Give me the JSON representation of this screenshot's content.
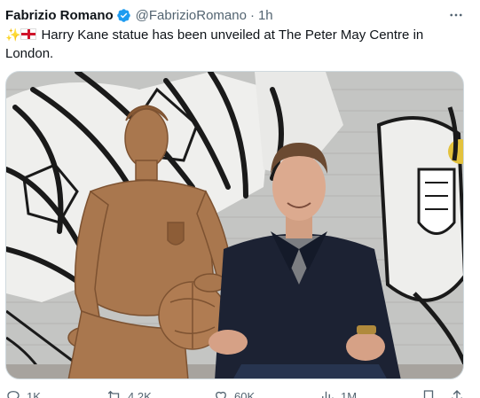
{
  "tweet": {
    "author": {
      "name": "Fabrizio Romano",
      "handle": "@FabrizioRomano",
      "separator": "·",
      "time": "1h",
      "verified_color": "#1d9bf0"
    },
    "text": "Harry Kane statue has been unveiled at The Peter May Centre in London.",
    "emoji": "✨",
    "flag": "england-flag",
    "media": {
      "alt": "Harry Kane sitting next to a bronze statue of himself holding a football, in front of a black-and-white mural"
    },
    "actions": {
      "reply": {
        "icon": "reply-icon",
        "count": "1K"
      },
      "retweet": {
        "icon": "retweet-icon",
        "count": "4.2K"
      },
      "like": {
        "icon": "like-icon",
        "count": "60K"
      },
      "views": {
        "icon": "views-icon",
        "count": "1M"
      },
      "bookmark": {
        "icon": "bookmark-icon"
      },
      "share": {
        "icon": "share-icon"
      }
    }
  },
  "colors": {
    "text": "#0f1419",
    "secondary": "#536471",
    "border": "#cfd9de",
    "bronze": "#a9774e"
  }
}
